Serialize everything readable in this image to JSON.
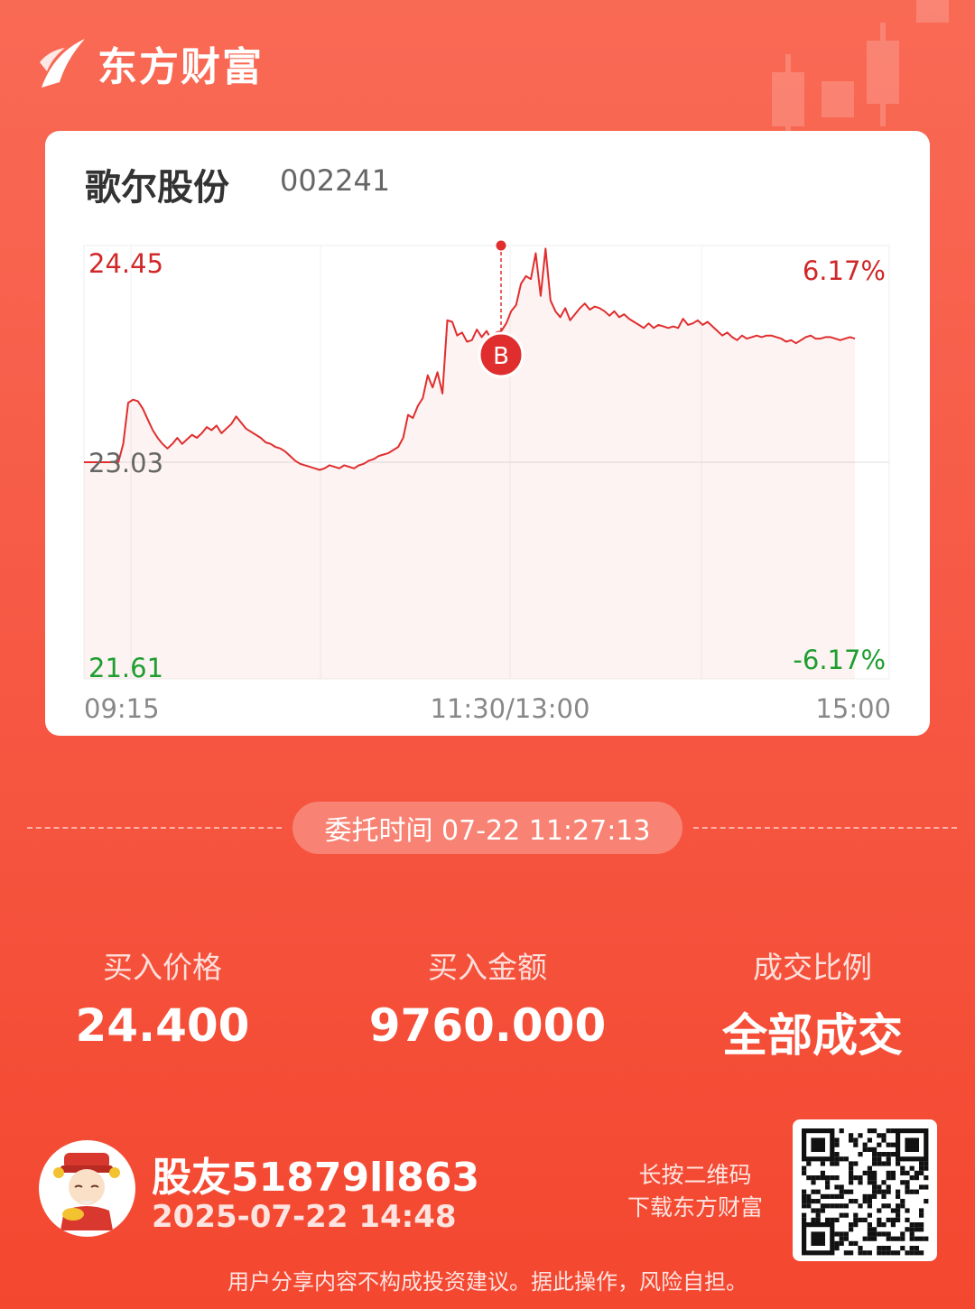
{
  "brand": {
    "name": "东方财富"
  },
  "stock": {
    "name": "歌尔股份",
    "code": "002241"
  },
  "chart_data": {
    "type": "line",
    "y_labels": {
      "top": "24.45",
      "mid": "23.03",
      "bottom": "21.61"
    },
    "pct_labels": {
      "top": "6.17%",
      "bottom": "-6.17%"
    },
    "x_labels": {
      "start": "09:15",
      "mid": "11:30/13:00",
      "end": "15:00"
    },
    "ylim": [
      21.61,
      24.45
    ],
    "prev_close": 23.03,
    "series": [
      {
        "values": [
          23.03,
          23.03,
          23.03,
          23.03,
          23.03,
          23.03,
          23.03,
          23.03,
          23.15,
          23.42,
          23.44,
          23.43,
          23.38,
          23.31,
          23.24,
          23.19,
          23.15,
          23.12,
          23.15,
          23.19,
          23.15,
          23.18,
          23.21,
          23.19,
          23.22,
          23.26,
          23.24,
          23.27,
          23.22,
          23.25,
          23.28,
          23.33,
          23.29,
          23.25,
          23.23,
          23.21,
          23.19,
          23.16,
          23.15,
          23.13,
          23.12,
          23.1,
          23.07,
          23.04,
          23.02,
          23.01,
          23.0,
          22.99,
          22.98,
          22.99,
          23.01,
          23.0,
          22.99,
          23.01,
          23.0,
          22.99,
          23.01,
          23.02,
          23.04,
          23.05,
          23.07,
          23.08,
          23.09,
          23.11,
          23.13,
          23.19,
          23.34,
          23.32,
          23.4,
          23.45,
          23.6,
          23.52,
          23.62,
          23.48,
          23.96,
          23.95,
          23.86,
          23.88,
          23.82,
          23.83,
          23.9,
          23.85,
          23.89,
          23.83,
          23.88,
          23.89,
          23.94,
          24.02,
          24.06,
          24.2,
          24.25,
          24.23,
          24.4,
          24.12,
          24.43,
          24.09,
          24.02,
          23.98,
          24.04,
          23.96,
          24.0,
          24.04,
          24.07,
          24.03,
          24.05,
          24.04,
          24.02,
          23.99,
          24.02,
          23.98,
          24.0,
          23.97,
          23.95,
          23.93,
          23.91,
          23.94,
          23.91,
          23.93,
          23.92,
          23.91,
          23.92,
          23.91,
          23.97,
          23.93,
          23.94,
          23.96,
          23.93,
          23.95,
          23.92,
          23.89,
          23.86,
          23.88,
          23.85,
          23.83,
          23.86,
          23.84,
          23.85,
          23.86,
          23.85,
          23.86,
          23.86,
          23.85,
          23.84,
          23.82,
          23.83,
          23.81,
          23.83,
          23.85,
          23.86,
          23.84,
          23.84,
          23.85,
          23.85,
          23.84,
          23.83,
          23.84,
          23.85,
          23.84
        ]
      }
    ],
    "marker": {
      "label": "B",
      "price": 24.45
    }
  },
  "commission": {
    "text": "委托时间 07-22 11:27:13"
  },
  "stats": [
    {
      "label": "买入价格",
      "value": "24.400"
    },
    {
      "label": "买入金额",
      "value": "9760.000"
    },
    {
      "label": "成交比例",
      "value": "全部成交"
    }
  ],
  "user": {
    "name": "股友51879ll863",
    "time": "2025-07-22 14:48"
  },
  "qr": {
    "hint_line1": "长按二维码",
    "hint_line2": "下载东方财富"
  },
  "disclaimer": "用户分享内容不构成投资建议。据此操作，风险自担。",
  "colors": {
    "up": "#e02e2e",
    "down": "#1e9e2e",
    "brand": "#f65a46"
  }
}
